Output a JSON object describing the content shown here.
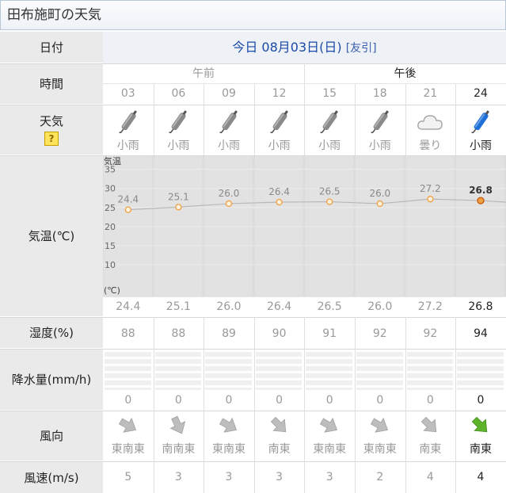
{
  "title": "田布施町の天気",
  "header": {
    "date_label": "日付",
    "date_value": "今日 08月03日(日)",
    "date_link": "[友引]"
  },
  "time_row": {
    "label": "時間",
    "am_label": "午前",
    "pm_label": "午後",
    "hours": [
      "03",
      "06",
      "09",
      "12",
      "15",
      "18",
      "21",
      "24"
    ]
  },
  "weather_row": {
    "label": "天気",
    "help_icon": "question-icon",
    "conditions": [
      "小雨",
      "小雨",
      "小雨",
      "小雨",
      "小雨",
      "小雨",
      "曇り",
      "小雨"
    ],
    "icons": [
      "umbrella-icon",
      "umbrella-icon",
      "umbrella-icon",
      "umbrella-icon",
      "umbrella-icon",
      "umbrella-icon",
      "cloud-icon",
      "umbrella-icon"
    ]
  },
  "temp_row": {
    "label": "気温(℃)",
    "axis_label_top": "気温",
    "axis_label_bottom": "(℃)",
    "values": [
      "24.4",
      "25.1",
      "26.0",
      "26.4",
      "26.5",
      "26.0",
      "27.2",
      "26.8"
    ]
  },
  "chart_data": {
    "type": "line",
    "x": [
      "03",
      "06",
      "09",
      "12",
      "15",
      "18",
      "21",
      "24"
    ],
    "values": [
      24.4,
      25.1,
      26.0,
      26.4,
      26.5,
      26.0,
      27.2,
      26.8
    ],
    "yticks": [
      35,
      30,
      25,
      20,
      15,
      10
    ],
    "ylim": [
      5,
      37
    ],
    "ylabel": "気温",
    "yunit": "(℃)"
  },
  "humidity_row": {
    "label": "湿度(%)",
    "values": [
      "88",
      "88",
      "89",
      "90",
      "91",
      "92",
      "92",
      "94"
    ]
  },
  "precip_row": {
    "label": "降水量(mm/h)",
    "values": [
      "0",
      "0",
      "0",
      "0",
      "0",
      "0",
      "0",
      "0"
    ]
  },
  "wind_dir_row": {
    "label": "風向",
    "values": [
      "東南東",
      "南南東",
      "東南東",
      "南東",
      "東南東",
      "東南東",
      "南東",
      "南東"
    ]
  },
  "wind_speed_row": {
    "label": "風速(m/s)",
    "values": [
      "5",
      "3",
      "3",
      "3",
      "3",
      "2",
      "4",
      "4"
    ]
  },
  "colors": {
    "label_bg": "#eaeaea",
    "active_icon": "#1e6fd8",
    "inactive_icon": "#8a8a8a",
    "line": "#f0a040",
    "arrow_active": "#5fb32b"
  }
}
